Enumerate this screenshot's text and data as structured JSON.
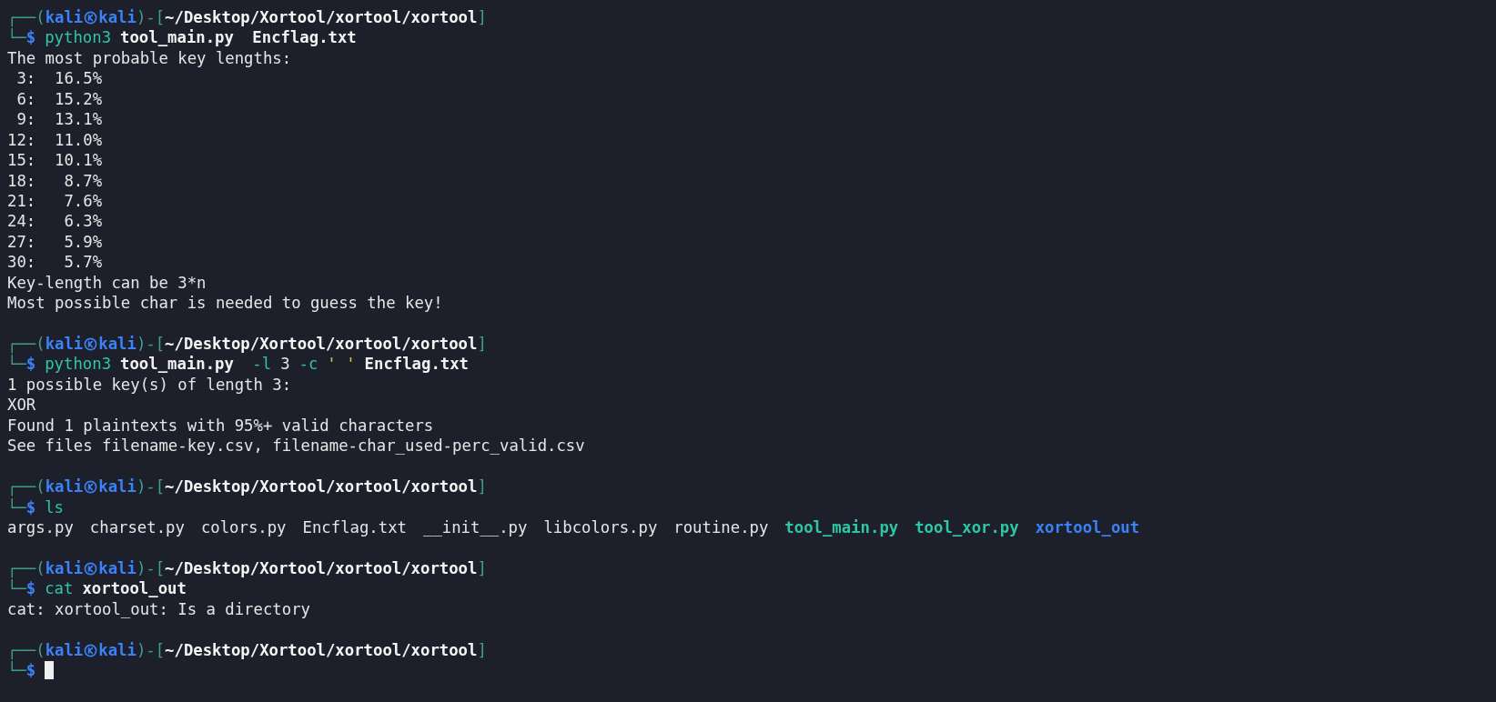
{
  "terminal": {
    "lines": [
      {
        "kind": "prompt",
        "frame_top": "┌──(",
        "user": "kali",
        "host": "kali",
        "mid": ")-[",
        "path": "~/Desktop/Xortool/xortool/xortool",
        "close": "]",
        "frame_bottom": "└─",
        "symbol": "$",
        "command": [
          {
            "kind": "cmd",
            "text": "python3"
          },
          {
            "kind": "arg",
            "text": "tool_main.py"
          },
          {
            "kind": "arg",
            "text": " Encflag.txt"
          }
        ]
      },
      {
        "kind": "output",
        "text": "The most probable key lengths:"
      },
      {
        "kind": "output",
        "text": " 3:  16.5%"
      },
      {
        "kind": "output",
        "text": " 6:  15.2%"
      },
      {
        "kind": "output",
        "text": " 9:  13.1%"
      },
      {
        "kind": "output",
        "text": "12:  11.0%"
      },
      {
        "kind": "output",
        "text": "15:  10.1%"
      },
      {
        "kind": "output",
        "text": "18:   8.7%"
      },
      {
        "kind": "output",
        "text": "21:   7.6%"
      },
      {
        "kind": "output",
        "text": "24:   6.3%"
      },
      {
        "kind": "output",
        "text": "27:   5.9%"
      },
      {
        "kind": "output",
        "text": "30:   5.7%"
      },
      {
        "kind": "output",
        "text": "Key-length can be 3*n"
      },
      {
        "kind": "output",
        "text": "Most possible char is needed to guess the key!"
      },
      {
        "kind": "blank"
      },
      {
        "kind": "prompt",
        "frame_top": "┌──(",
        "user": "kali",
        "host": "kali",
        "mid": ")-[",
        "path": "~/Desktop/Xortool/xortool/xortool",
        "close": "]",
        "frame_bottom": "└─",
        "symbol": "$",
        "command": [
          {
            "kind": "cmd",
            "text": "python3"
          },
          {
            "kind": "arg",
            "text": "tool_main.py"
          },
          {
            "kind": "opt",
            "text": " -l"
          },
          {
            "kind": "plain",
            "text": "3"
          },
          {
            "kind": "opt",
            "text": "-c"
          },
          {
            "kind": "str",
            "text": "' '"
          },
          {
            "kind": "arg",
            "text": "Encflag.txt"
          }
        ]
      },
      {
        "kind": "output",
        "text": "1 possible key(s) of length 3:"
      },
      {
        "kind": "output",
        "text": "XOR"
      },
      {
        "kind": "output",
        "text": "Found 1 plaintexts with 95%+ valid characters"
      },
      {
        "kind": "output",
        "text": "See files filename-key.csv, filename-char_used-perc_valid.csv"
      },
      {
        "kind": "blank"
      },
      {
        "kind": "prompt",
        "frame_top": "┌──(",
        "user": "kali",
        "host": "kali",
        "mid": ")-[",
        "path": "~/Desktop/Xortool/xortool/xortool",
        "close": "]",
        "frame_bottom": "└─",
        "symbol": "$",
        "command": [
          {
            "kind": "cmd",
            "text": "ls"
          }
        ]
      },
      {
        "kind": "files",
        "items": [
          {
            "kind": "file",
            "name": "args.py"
          },
          {
            "kind": "file",
            "name": "charset.py"
          },
          {
            "kind": "file",
            "name": "colors.py"
          },
          {
            "kind": "file",
            "name": "Encflag.txt"
          },
          {
            "kind": "file",
            "name": "__init__.py"
          },
          {
            "kind": "file",
            "name": "libcolors.py"
          },
          {
            "kind": "file",
            "name": "routine.py"
          },
          {
            "kind": "exec",
            "name": "tool_main.py"
          },
          {
            "kind": "exec",
            "name": "tool_xor.py"
          },
          {
            "kind": "dir",
            "name": "xortool_out"
          }
        ]
      },
      {
        "kind": "blank"
      },
      {
        "kind": "prompt",
        "frame_top": "┌──(",
        "user": "kali",
        "host": "kali",
        "mid": ")-[",
        "path": "~/Desktop/Xortool/xortool/xortool",
        "close": "]",
        "frame_bottom": "└─",
        "symbol": "$",
        "command": [
          {
            "kind": "cmd",
            "text": "cat"
          },
          {
            "kind": "arg",
            "text": "xortool_out"
          }
        ]
      },
      {
        "kind": "output",
        "text": "cat: xortool_out: Is a directory"
      },
      {
        "kind": "blank"
      },
      {
        "kind": "prompt",
        "frame_top": "┌──(",
        "user": "kali",
        "host": "kali",
        "mid": ")-[",
        "path": "~/Desktop/Xortool/xortool/xortool",
        "close": "]",
        "frame_bottom": "└─",
        "symbol": "$",
        "cursor": true
      }
    ]
  }
}
